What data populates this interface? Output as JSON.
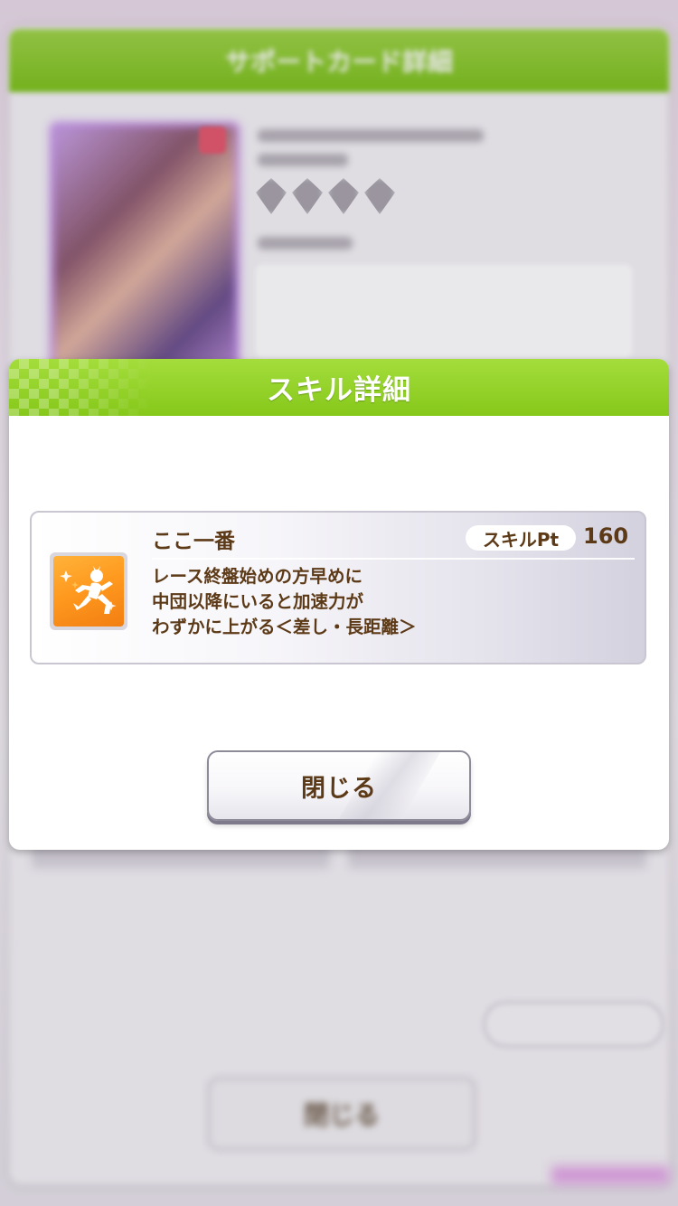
{
  "background": {
    "header_title": "サポートカード詳細",
    "close_label": "閉じる"
  },
  "dialog": {
    "title": "スキル詳細",
    "skill": {
      "icon": "running-figure-icon",
      "name": "ここ一番",
      "pt_label": "スキルPt",
      "pt_value": "160",
      "description_lines": [
        "レース終盤始めの方早めに",
        "中団以降にいると加速力が",
        "わずかに上がる＜差し・長距離＞"
      ]
    },
    "close_label": "閉じる"
  },
  "colors": {
    "header_green": "#86c81a",
    "text_brown": "#5d3a17",
    "icon_orange": "#ff9a1f"
  }
}
